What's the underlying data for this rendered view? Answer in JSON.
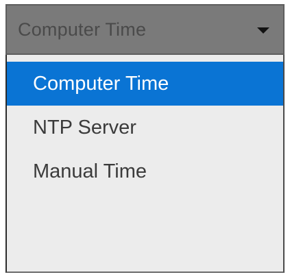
{
  "dropdown": {
    "selected_value": "Computer Time",
    "icon": "chevron-down-icon",
    "options": [
      {
        "label": "Computer Time",
        "highlighted": true
      },
      {
        "label": "NTP Server",
        "highlighted": false
      },
      {
        "label": "Manual Time",
        "highlighted": false
      }
    ]
  },
  "colors": {
    "highlight": "#0a74d4",
    "list_background": "#ececec",
    "header_background": "#7a7a7a"
  }
}
